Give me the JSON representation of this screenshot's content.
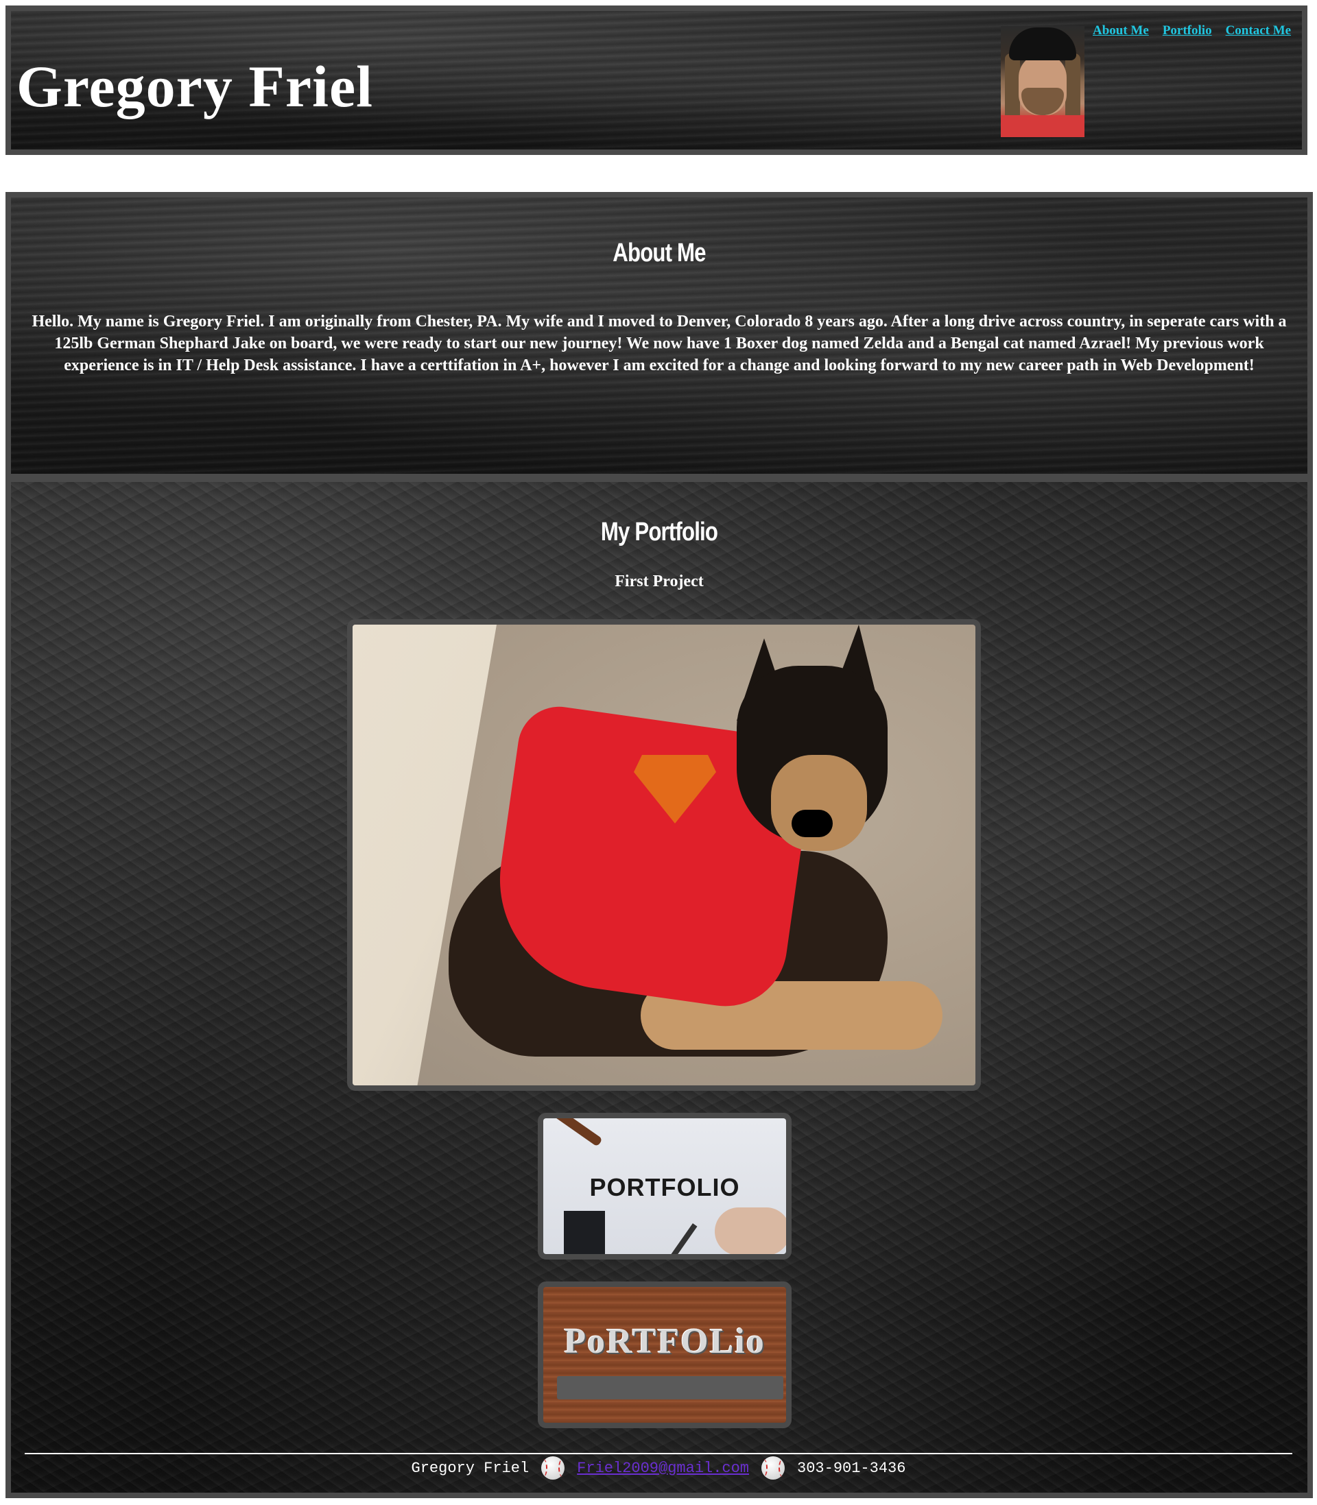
{
  "header": {
    "title": "Gregory Friel",
    "nav": [
      "About Me",
      "Portfolio",
      "Contact Me"
    ]
  },
  "about": {
    "heading": "About Me",
    "text": "Hello. My name is Gregory Friel. I am originally from Chester, PA. My wife and I moved to Denver, Colorado 8 years ago. After a long drive across country, in seperate cars with a 125lb German Shephard Jake on board, we were ready to start our new journey! We now have 1 Boxer dog named Zelda and a Bengal cat named Azrael! My previous work experience is in IT / Help Desk assistance. I have a certtifation in A+, however I am excited for a change and looking forward to my new career path in Web Development!"
  },
  "portfolio": {
    "heading": "My Portfolio",
    "project_title": "First Project",
    "cards": [
      {
        "text": "PORTFOLIO"
      },
      {
        "text": "PoRTFOLio"
      }
    ]
  },
  "footer": {
    "name": "Gregory Friel",
    "email": "Friel2009@gmail.com",
    "phone": "303-901-3436",
    "icon": "baseball-icon"
  },
  "colors": {
    "nav_link": "#20c6e0",
    "border": "#4a4a4a",
    "email_link": "#6a2fd0"
  }
}
